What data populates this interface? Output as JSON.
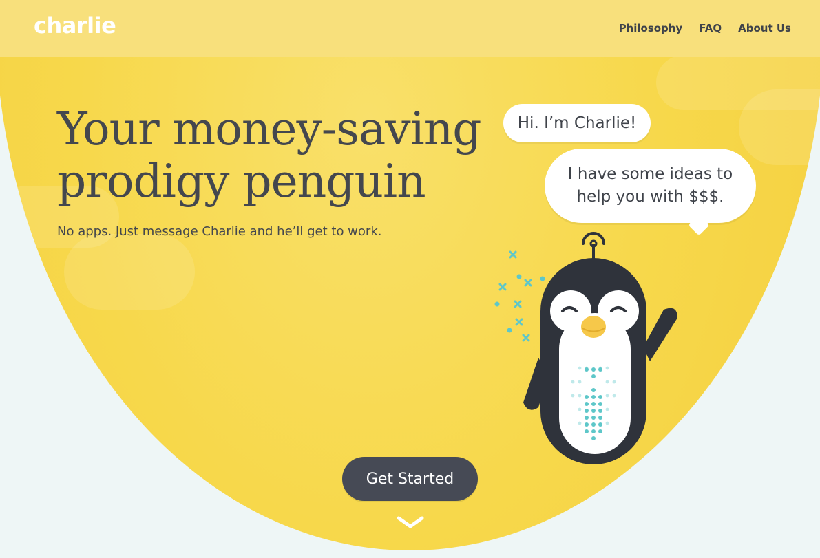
{
  "brand": {
    "logo_text": "charlie"
  },
  "nav": {
    "items": [
      {
        "label": "Philosophy"
      },
      {
        "label": "FAQ"
      },
      {
        "label": "About Us"
      }
    ]
  },
  "hero": {
    "headline_line1": "Your money-saving",
    "headline_line2": "prodigy penguin",
    "subheadline": "No apps. Just message Charlie and he’ll get to work.",
    "cta_label": "Get Started"
  },
  "bubbles": {
    "greeting": "Hi. I’m Charlie!",
    "ideas_line1": "I have some ideas to",
    "ideas_line2": "help you with $$$."
  },
  "icons": {
    "scroll": "chevron-down-icon",
    "mascot": "penguin-icon",
    "sparkles": "sparkle-icon"
  },
  "colors": {
    "yellow": "#f7d84b",
    "topbar": "#f8e07c",
    "dark": "#464a55",
    "teal": "#5ec7c9",
    "background": "#eef6f6"
  }
}
